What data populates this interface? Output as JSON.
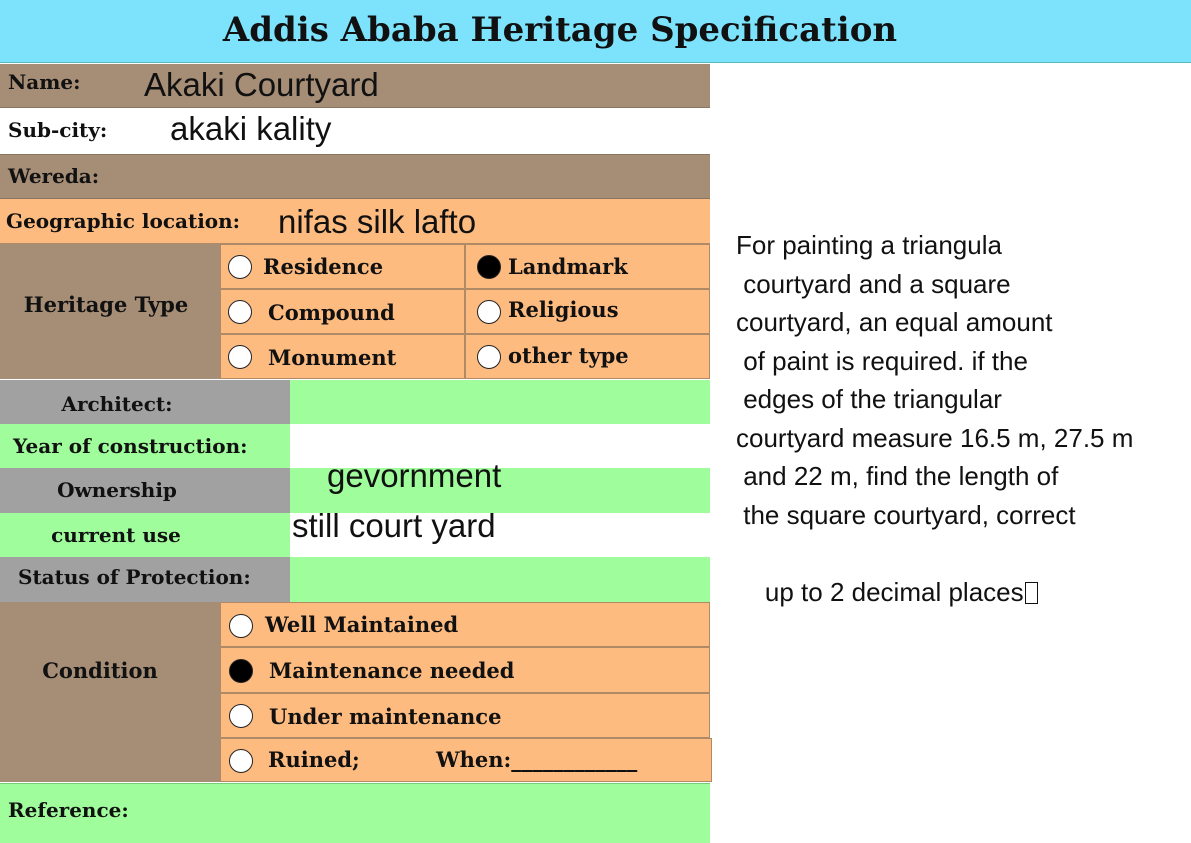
{
  "title": "Addis Ababa Heritage Specification",
  "fields": {
    "name_label": "Name:",
    "name_value": "Akaki Courtyard",
    "subcity_label": "Sub-city:",
    "subcity_value": "akaki kality",
    "wereda_label": "Wereda:",
    "geo_label": "Geographic location:",
    "geo_value": "nifas silk lafto",
    "architect_label": "Architect:",
    "year_label": "Year of construction:",
    "ownership_label": "Ownership",
    "ownership_value": "gevornment",
    "current_use_label": "current use",
    "current_use_value": "still court yard",
    "status_label": "Status of Protection:",
    "reference_label": "Reference:"
  },
  "heritage_type": {
    "label": "Heritage Type",
    "options": [
      {
        "label": "Residence",
        "selected": false
      },
      {
        "label": "Landmark",
        "selected": true
      },
      {
        "label": "Compound",
        "selected": false
      },
      {
        "label": "Religious",
        "selected": false
      },
      {
        "label": "Monument",
        "selected": false
      },
      {
        "label": "other type",
        "selected": false
      }
    ]
  },
  "condition": {
    "label": "Condition",
    "options": [
      {
        "label": "Well Maintained",
        "selected": false
      },
      {
        "label": "Maintenance needed",
        "selected": true
      },
      {
        "label": "Under maintenance",
        "selected": false
      },
      {
        "label": "Ruined;",
        "selected": false
      }
    ],
    "when_label": "When:____________"
  },
  "problem_text": [
    "For painting a triangula",
    " courtyard and a square",
    "courtyard, an equal amount",
    " of paint is required. if the",
    " edges of the triangular",
    "courtyard measure 16.5 m, 27.5 m",
    " and 22 m, find the length of",
    " the square courtyard, correct",
    "up to 2 decimal places"
  ],
  "colors": {
    "header": "#7de3fd",
    "brown": "#a68d75",
    "orange": "#fdbb80",
    "green": "#9ffd9b",
    "grey": "#a1a1a1"
  }
}
